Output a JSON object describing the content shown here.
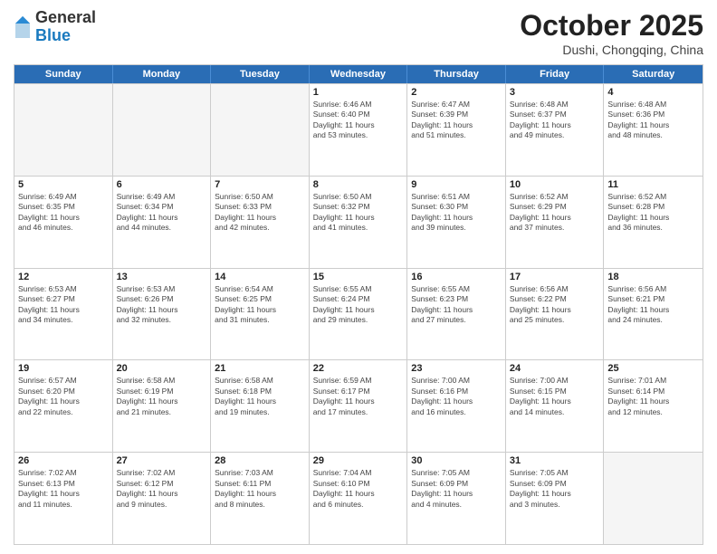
{
  "logo": {
    "general": "General",
    "blue": "Blue"
  },
  "header": {
    "month": "October 2025",
    "location": "Dushi, Chongqing, China"
  },
  "weekdays": [
    "Sunday",
    "Monday",
    "Tuesday",
    "Wednesday",
    "Thursday",
    "Friday",
    "Saturday"
  ],
  "rows": [
    [
      {
        "day": "",
        "info": ""
      },
      {
        "day": "",
        "info": ""
      },
      {
        "day": "",
        "info": ""
      },
      {
        "day": "1",
        "info": "Sunrise: 6:46 AM\nSunset: 6:40 PM\nDaylight: 11 hours\nand 53 minutes."
      },
      {
        "day": "2",
        "info": "Sunrise: 6:47 AM\nSunset: 6:39 PM\nDaylight: 11 hours\nand 51 minutes."
      },
      {
        "day": "3",
        "info": "Sunrise: 6:48 AM\nSunset: 6:37 PM\nDaylight: 11 hours\nand 49 minutes."
      },
      {
        "day": "4",
        "info": "Sunrise: 6:48 AM\nSunset: 6:36 PM\nDaylight: 11 hours\nand 48 minutes."
      }
    ],
    [
      {
        "day": "5",
        "info": "Sunrise: 6:49 AM\nSunset: 6:35 PM\nDaylight: 11 hours\nand 46 minutes."
      },
      {
        "day": "6",
        "info": "Sunrise: 6:49 AM\nSunset: 6:34 PM\nDaylight: 11 hours\nand 44 minutes."
      },
      {
        "day": "7",
        "info": "Sunrise: 6:50 AM\nSunset: 6:33 PM\nDaylight: 11 hours\nand 42 minutes."
      },
      {
        "day": "8",
        "info": "Sunrise: 6:50 AM\nSunset: 6:32 PM\nDaylight: 11 hours\nand 41 minutes."
      },
      {
        "day": "9",
        "info": "Sunrise: 6:51 AM\nSunset: 6:30 PM\nDaylight: 11 hours\nand 39 minutes."
      },
      {
        "day": "10",
        "info": "Sunrise: 6:52 AM\nSunset: 6:29 PM\nDaylight: 11 hours\nand 37 minutes."
      },
      {
        "day": "11",
        "info": "Sunrise: 6:52 AM\nSunset: 6:28 PM\nDaylight: 11 hours\nand 36 minutes."
      }
    ],
    [
      {
        "day": "12",
        "info": "Sunrise: 6:53 AM\nSunset: 6:27 PM\nDaylight: 11 hours\nand 34 minutes."
      },
      {
        "day": "13",
        "info": "Sunrise: 6:53 AM\nSunset: 6:26 PM\nDaylight: 11 hours\nand 32 minutes."
      },
      {
        "day": "14",
        "info": "Sunrise: 6:54 AM\nSunset: 6:25 PM\nDaylight: 11 hours\nand 31 minutes."
      },
      {
        "day": "15",
        "info": "Sunrise: 6:55 AM\nSunset: 6:24 PM\nDaylight: 11 hours\nand 29 minutes."
      },
      {
        "day": "16",
        "info": "Sunrise: 6:55 AM\nSunset: 6:23 PM\nDaylight: 11 hours\nand 27 minutes."
      },
      {
        "day": "17",
        "info": "Sunrise: 6:56 AM\nSunset: 6:22 PM\nDaylight: 11 hours\nand 25 minutes."
      },
      {
        "day": "18",
        "info": "Sunrise: 6:56 AM\nSunset: 6:21 PM\nDaylight: 11 hours\nand 24 minutes."
      }
    ],
    [
      {
        "day": "19",
        "info": "Sunrise: 6:57 AM\nSunset: 6:20 PM\nDaylight: 11 hours\nand 22 minutes."
      },
      {
        "day": "20",
        "info": "Sunrise: 6:58 AM\nSunset: 6:19 PM\nDaylight: 11 hours\nand 21 minutes."
      },
      {
        "day": "21",
        "info": "Sunrise: 6:58 AM\nSunset: 6:18 PM\nDaylight: 11 hours\nand 19 minutes."
      },
      {
        "day": "22",
        "info": "Sunrise: 6:59 AM\nSunset: 6:17 PM\nDaylight: 11 hours\nand 17 minutes."
      },
      {
        "day": "23",
        "info": "Sunrise: 7:00 AM\nSunset: 6:16 PM\nDaylight: 11 hours\nand 16 minutes."
      },
      {
        "day": "24",
        "info": "Sunrise: 7:00 AM\nSunset: 6:15 PM\nDaylight: 11 hours\nand 14 minutes."
      },
      {
        "day": "25",
        "info": "Sunrise: 7:01 AM\nSunset: 6:14 PM\nDaylight: 11 hours\nand 12 minutes."
      }
    ],
    [
      {
        "day": "26",
        "info": "Sunrise: 7:02 AM\nSunset: 6:13 PM\nDaylight: 11 hours\nand 11 minutes."
      },
      {
        "day": "27",
        "info": "Sunrise: 7:02 AM\nSunset: 6:12 PM\nDaylight: 11 hours\nand 9 minutes."
      },
      {
        "day": "28",
        "info": "Sunrise: 7:03 AM\nSunset: 6:11 PM\nDaylight: 11 hours\nand 8 minutes."
      },
      {
        "day": "29",
        "info": "Sunrise: 7:04 AM\nSunset: 6:10 PM\nDaylight: 11 hours\nand 6 minutes."
      },
      {
        "day": "30",
        "info": "Sunrise: 7:05 AM\nSunset: 6:09 PM\nDaylight: 11 hours\nand 4 minutes."
      },
      {
        "day": "31",
        "info": "Sunrise: 7:05 AM\nSunset: 6:09 PM\nDaylight: 11 hours\nand 3 minutes."
      },
      {
        "day": "",
        "info": ""
      }
    ]
  ]
}
